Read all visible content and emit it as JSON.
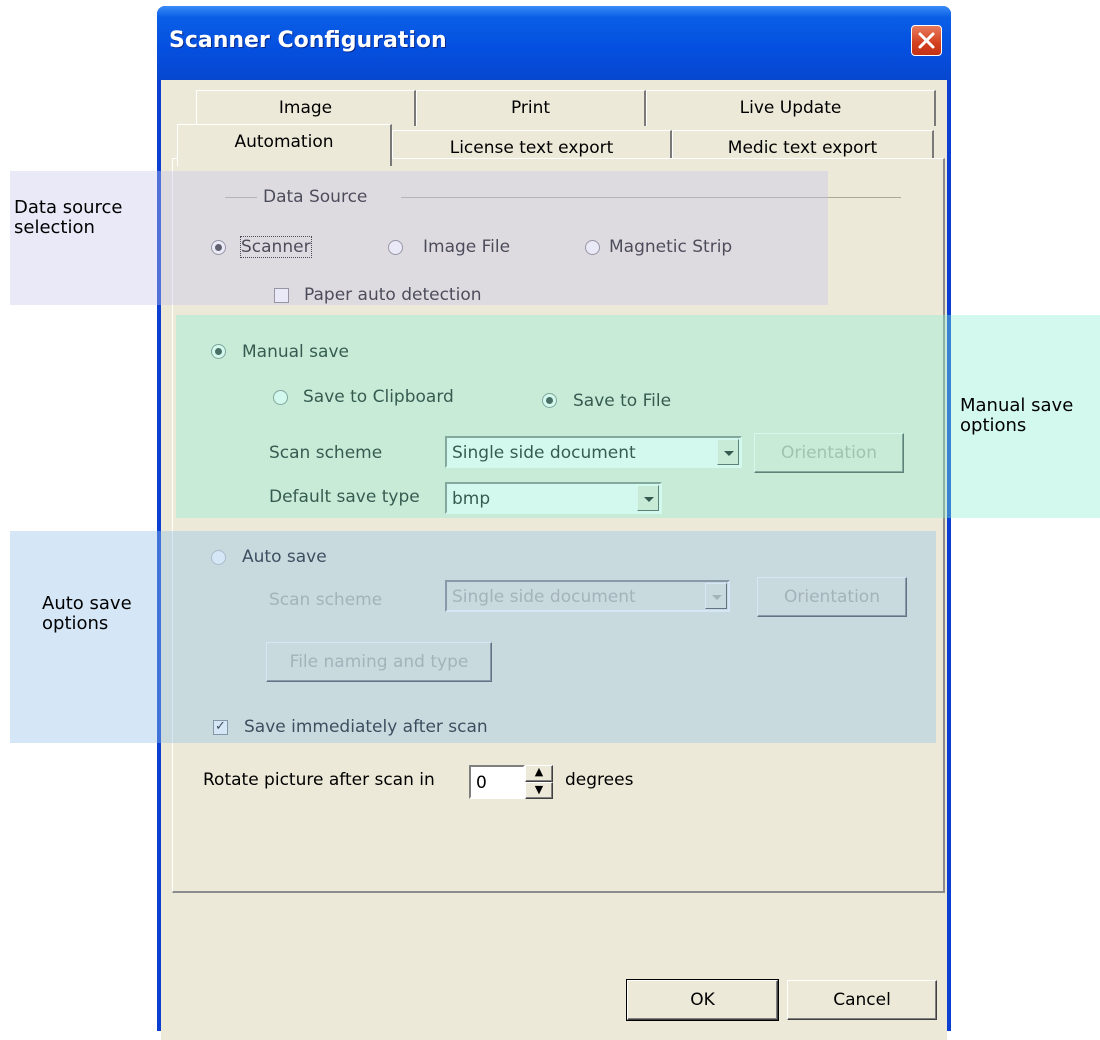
{
  "window": {
    "title": "Scanner Configuration",
    "close_icon": "close-icon"
  },
  "tabs": {
    "row_back": [
      "Image",
      "Print",
      "Live Update"
    ],
    "row_front": [
      "Automation",
      "License text export",
      "Medic text export"
    ],
    "selected": "Automation"
  },
  "data_source": {
    "group_label": "Data Source",
    "options": [
      "Scanner",
      "Image File",
      "Magnetic Strip"
    ],
    "selected": "Scanner",
    "paper_auto_detection_label": "Paper auto detection",
    "paper_auto_detection_checked": false
  },
  "manual_save": {
    "label": "Manual save",
    "selected": true,
    "clipboard_label": "Save to Clipboard",
    "file_label": "Save to File",
    "target_selected": "Save to File",
    "scan_scheme_label": "Scan scheme",
    "scan_scheme_value": "Single side document",
    "orientation_label": "Orientation",
    "default_save_type_label": "Default save type",
    "default_save_type_value": "bmp"
  },
  "auto_save": {
    "label": "Auto save",
    "selected": false,
    "scan_scheme_label": "Scan scheme",
    "scan_scheme_value": "Single side document",
    "orientation_label": "Orientation",
    "file_naming_label": "File naming and type",
    "save_immediately_label": "Save immediately after scan",
    "save_immediately_checked": true
  },
  "rotate": {
    "prefix": "Rotate picture after scan in",
    "value": "0",
    "suffix": "degrees"
  },
  "buttons": {
    "ok": "OK",
    "cancel": "Cancel"
  },
  "annotations": {
    "data_source_line1": "Data source",
    "data_source_line2": "selection",
    "manual_save_line1": "Manual save",
    "manual_save_line2": "options",
    "auto_save_line1": "Auto save",
    "auto_save_line2": "options"
  },
  "colors": {
    "titlebar": "#0550e0",
    "dialog_face": "#ece9d8",
    "zone_data_source": "#e8e6f4",
    "zone_manual_save": "#d4f6ee",
    "zone_auto_save": "#d4e3f2"
  }
}
